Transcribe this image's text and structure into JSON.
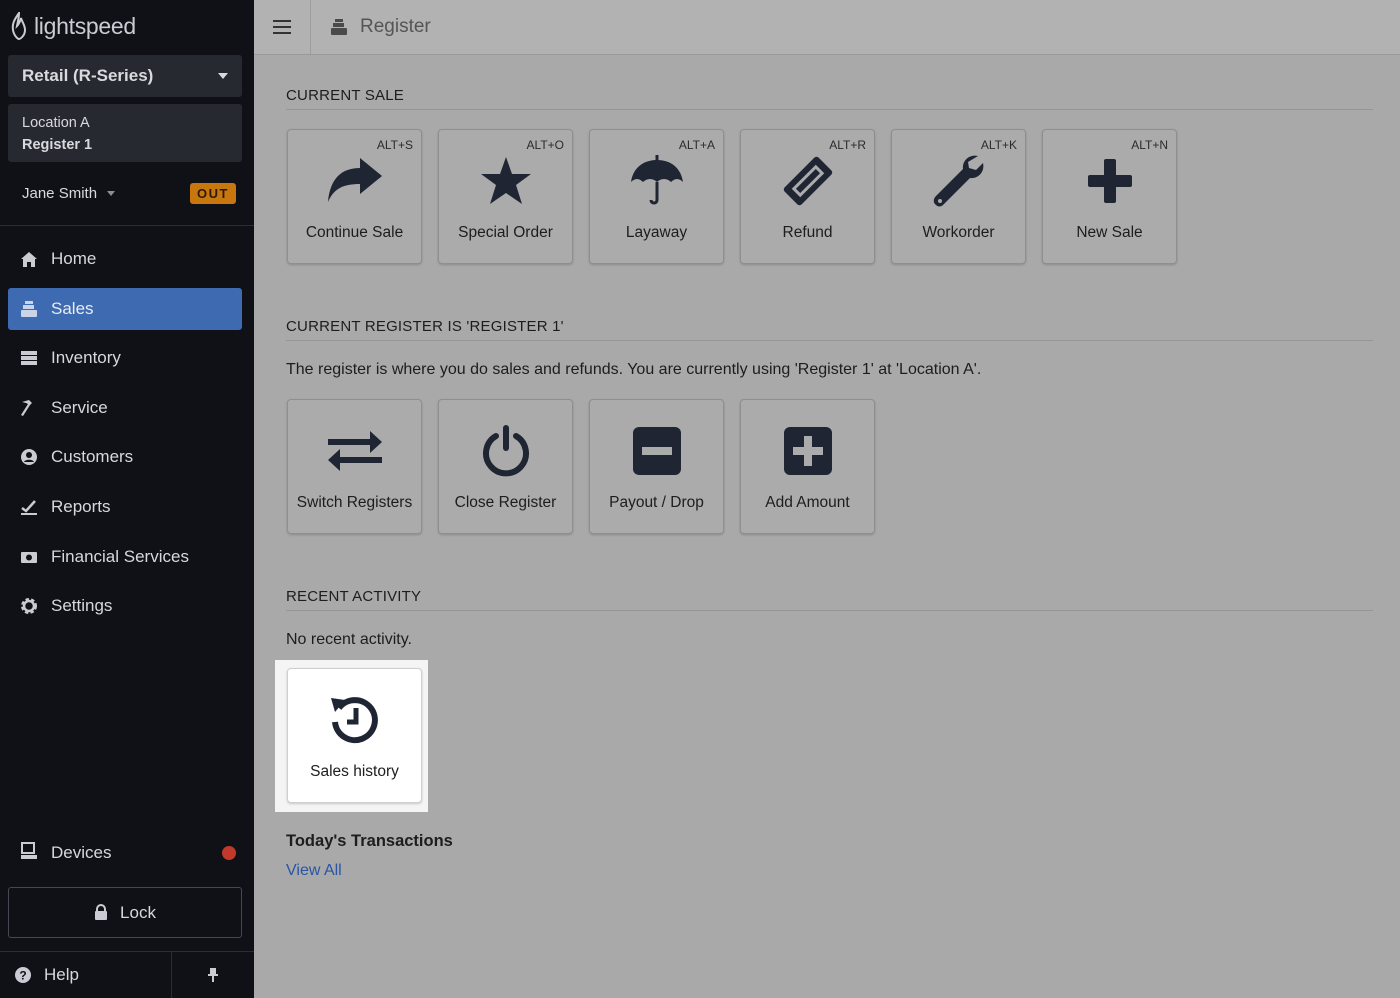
{
  "sidebar": {
    "logo_text": "lightspeed",
    "product": "Retail (R-Series)",
    "location": "Location A",
    "register": "Register 1",
    "user": "Jane Smith",
    "status_badge": "OUT",
    "nav": [
      {
        "label": "Home",
        "icon": "home-icon",
        "active": false
      },
      {
        "label": "Sales",
        "icon": "register-icon",
        "active": true
      },
      {
        "label": "Inventory",
        "icon": "inventory-icon",
        "active": false
      },
      {
        "label": "Service",
        "icon": "hammer-icon",
        "active": false
      },
      {
        "label": "Customers",
        "icon": "user-circle-icon",
        "active": false
      },
      {
        "label": "Reports",
        "icon": "chart-icon",
        "active": false
      },
      {
        "label": "Financial Services",
        "icon": "cash-icon",
        "active": false
      },
      {
        "label": "Settings",
        "icon": "gear-icon",
        "active": false
      }
    ],
    "devices_label": "Devices",
    "lock_label": "Lock",
    "help_label": "Help"
  },
  "topbar": {
    "title": "Register"
  },
  "current_sale": {
    "heading": "CURRENT SALE",
    "tiles": [
      {
        "label": "Continue Sale",
        "shortcut": "ALT+S",
        "icon": "share-arrow-icon"
      },
      {
        "label": "Special Order",
        "shortcut": "ALT+O",
        "icon": "star-icon"
      },
      {
        "label": "Layaway",
        "shortcut": "ALT+A",
        "icon": "umbrella-icon"
      },
      {
        "label": "Refund",
        "shortcut": "ALT+R",
        "icon": "ticket-icon"
      },
      {
        "label": "Workorder",
        "shortcut": "ALT+K",
        "icon": "wrench-icon"
      },
      {
        "label": "New Sale",
        "shortcut": "ALT+N",
        "icon": "plus-icon"
      }
    ]
  },
  "current_register": {
    "heading": "CURRENT REGISTER IS 'REGISTER 1'",
    "description": "The register is where you do sales and refunds. You are currently using 'Register 1'  at 'Location A'.",
    "tiles": [
      {
        "label": "Switch Registers",
        "icon": "exchange-icon"
      },
      {
        "label": "Close Register",
        "icon": "power-icon"
      },
      {
        "label": "Payout / Drop",
        "icon": "minus-square-icon"
      },
      {
        "label": "Add Amount",
        "icon": "plus-square-icon"
      }
    ]
  },
  "recent_activity": {
    "heading": "RECENT ACTIVITY",
    "empty_text": "No recent activity.",
    "sales_history_label": "Sales history"
  },
  "today": {
    "heading": "Today's Transactions",
    "view_all": "View All"
  },
  "colors": {
    "sidebar_bg": "#0f1117",
    "active_nav": "#3d6ab0",
    "badge": "#c8770f",
    "link": "#2a55a5",
    "icon_dark": "#1f2533"
  }
}
